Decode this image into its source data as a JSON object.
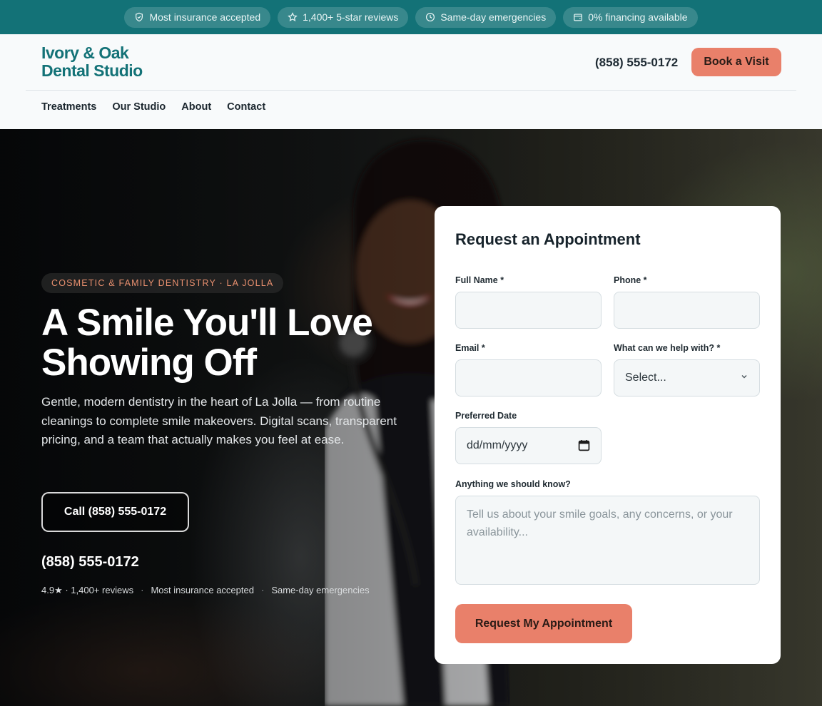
{
  "topbar": {
    "items": [
      {
        "icon": "shield-check-icon",
        "label": "Most insurance accepted"
      },
      {
        "icon": "star-icon",
        "label": "1,400+ 5-star reviews"
      },
      {
        "icon": "clock-icon",
        "label": "Same-day emergencies"
      },
      {
        "icon": "wallet-icon",
        "label": "0% financing available"
      }
    ]
  },
  "header": {
    "logo_line1": "Ivory & Oak",
    "logo_line2": "Dental Studio",
    "phone": "(858) 555-0172",
    "book_label": "Book a Visit",
    "nav": [
      "Treatments",
      "Our Studio",
      "About",
      "Contact"
    ]
  },
  "hero": {
    "badge": "COSMETIC & FAMILY DENTISTRY · LA JOLLA",
    "title_line1": "A Smile You'll Love",
    "title_line2": "Showing Off",
    "description": "Gentle, modern dentistry in the heart of La Jolla — from routine cleanings to complete smile makeovers. Digital scans, transparent pricing, and a team that actually makes you feel at ease.",
    "call_label": "Call (858) 555-0172",
    "phone": "(858) 555-0172",
    "stats": [
      "4.9★ · 1,400+ reviews",
      "Most insurance accepted",
      "Same-day emergencies"
    ],
    "separator": "·"
  },
  "form": {
    "title": "Request an Appointment",
    "full_name_label": "Full Name *",
    "phone_label": "Phone *",
    "email_label": "Email *",
    "help_label": "What can we help with? *",
    "help_value": "Select...",
    "date_label": "Preferred Date",
    "date_placeholder": "dd/mm/yyyy",
    "notes_label": "Anything we should know?",
    "notes_placeholder": "Tell us about your smile goals, any concerns, or your availability...",
    "submit_label": "Request My Appointment"
  },
  "colors": {
    "brand_teal": "#137277",
    "accent_coral": "#e9806a"
  }
}
